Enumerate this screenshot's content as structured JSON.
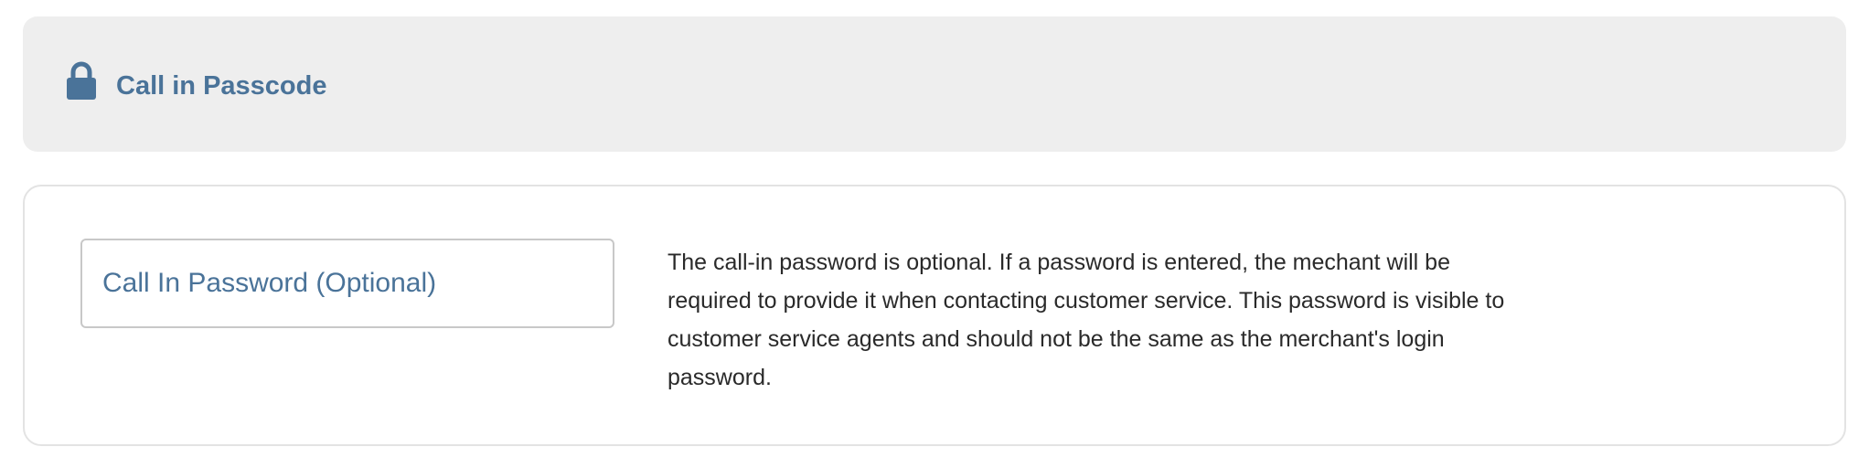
{
  "header": {
    "icon": "lock-icon",
    "title": "Call in Passcode"
  },
  "form": {
    "password_placeholder": "Call In Password (Optional)",
    "password_value": "",
    "help_text": "The call-in password is optional. If a password is entered, the mechant will be required to provide it when contacting customer service. This password is visible to customer service agents and should not be the same as the merchant's login password."
  },
  "colors": {
    "accent": "#4a7399",
    "header_background": "#eeeeee",
    "panel_border": "#e3e3e3",
    "text": "#2a2a2a"
  }
}
